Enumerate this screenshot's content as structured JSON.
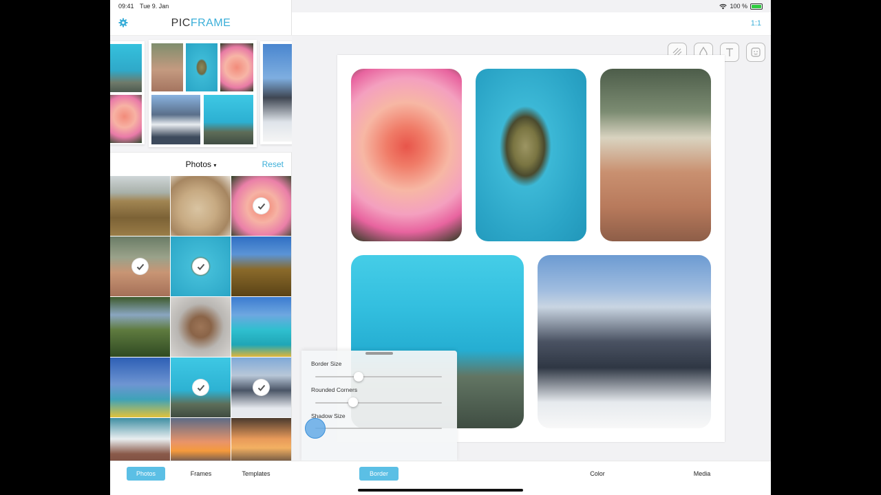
{
  "status_bar": {
    "time": "09:41",
    "date": "Tue 9. Jan",
    "battery_text": "100 %"
  },
  "app": {
    "logo_part1": "PIC",
    "logo_part2": "FRAME",
    "ratio_label": "1:1"
  },
  "photos_header": {
    "source_label": "Photos",
    "reset_label": "Reset"
  },
  "photo_grid": [
    {
      "name": "wheat-field",
      "selected": false
    },
    {
      "name": "dog",
      "selected": false
    },
    {
      "name": "rose",
      "selected": true
    },
    {
      "name": "coral-reef",
      "selected": true
    },
    {
      "name": "sea-turtle",
      "selected": true
    },
    {
      "name": "eiffel-tower",
      "selected": false
    },
    {
      "name": "forest-lake",
      "selected": false
    },
    {
      "name": "snow-monkey",
      "selected": false
    },
    {
      "name": "monkey-kayak",
      "selected": false
    },
    {
      "name": "kayak-girl",
      "selected": false
    },
    {
      "name": "underwater",
      "selected": true
    },
    {
      "name": "mountains",
      "selected": true
    },
    {
      "name": "beach-waves",
      "selected": false
    },
    {
      "name": "sunset-sea",
      "selected": false
    },
    {
      "name": "pier-sunset",
      "selected": false
    }
  ],
  "slider_panel": {
    "border_size_label": "Border Size",
    "rounded_corners_label": "Rounded Corners",
    "shadow_size_label": "Shadow Size",
    "border_size_value": 0.34,
    "rounded_corners_value": 0.3,
    "shadow_size_value": 0.0
  },
  "left_tabs": {
    "photos": "Photos",
    "frames": "Frames",
    "templates": "Templates"
  },
  "right_tabs": {
    "border": "Border",
    "color": "Color",
    "media": "Media"
  },
  "colors": {
    "accent": "#3aaed8",
    "tab_active": "#5bbfe5"
  },
  "icons": [
    "settings-gear-icon",
    "texture-tool-icon",
    "drop-tool-icon",
    "text-tool-icon",
    "sticker-tool-icon",
    "share-icon",
    "checkmark-icon",
    "dropdown-caret-icon"
  ]
}
